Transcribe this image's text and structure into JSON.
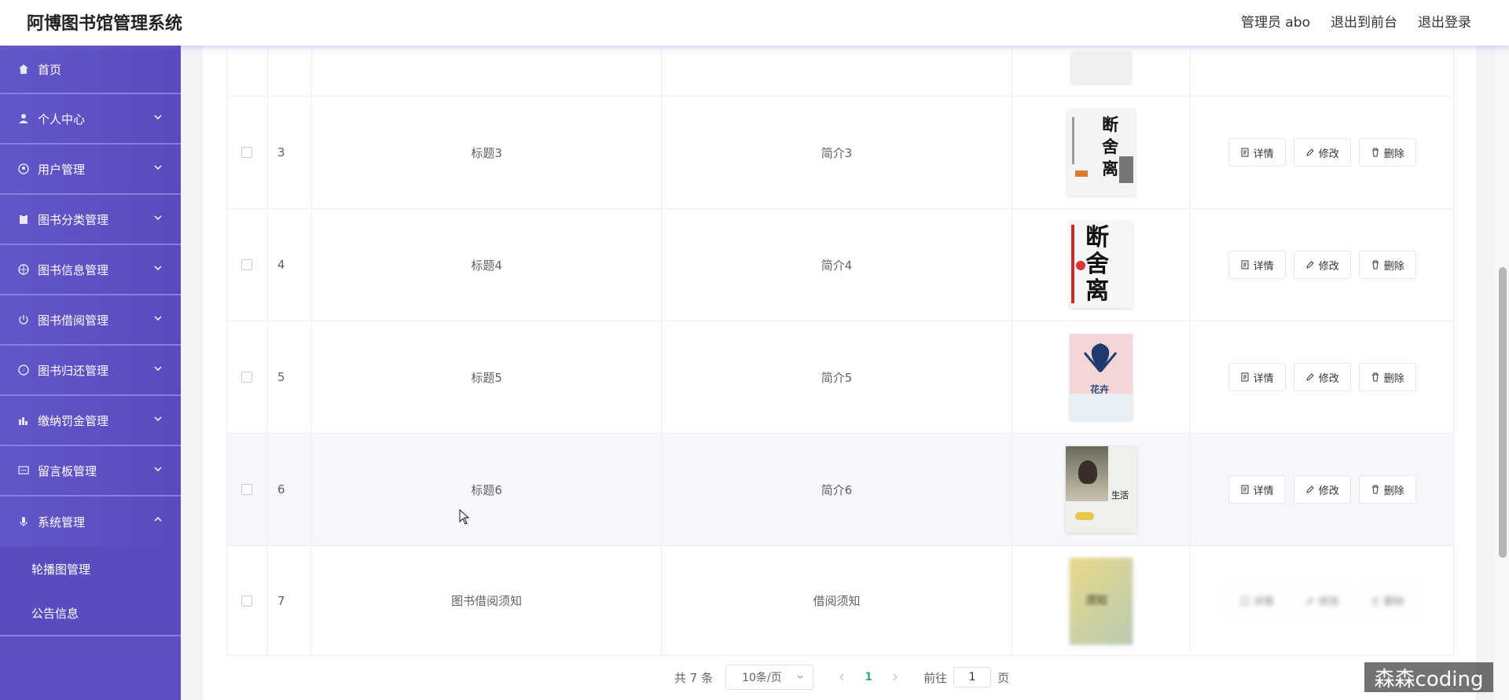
{
  "header": {
    "app_title": "阿博图书馆管理系统",
    "admin_label": "管理员 abo",
    "front_link": "退出到前台",
    "logout_link": "退出登录"
  },
  "sidebar": {
    "items": [
      {
        "label": "首页",
        "icon": "home-icon"
      },
      {
        "label": "个人中心",
        "icon": "user-icon"
      },
      {
        "label": "用户管理",
        "icon": "users-icon"
      },
      {
        "label": "图书分类管理",
        "icon": "clipboard-icon"
      },
      {
        "label": "图书信息管理",
        "icon": "globe-icon"
      },
      {
        "label": "图书借阅管理",
        "icon": "power-icon"
      },
      {
        "label": "图书归还管理",
        "icon": "compass-icon"
      },
      {
        "label": "缴纳罚金管理",
        "icon": "chart-icon"
      },
      {
        "label": "留言板管理",
        "icon": "message-icon"
      },
      {
        "label": "系统管理",
        "icon": "mic-icon"
      }
    ],
    "sub_items": [
      {
        "label": "轮播图管理"
      },
      {
        "label": "公告信息"
      }
    ]
  },
  "table": {
    "rows": [
      {
        "index": "3",
        "title": "标题3",
        "intro": "简介3",
        "cover": "断舍离"
      },
      {
        "index": "4",
        "title": "标题4",
        "intro": "简介4",
        "cover": "断舍离"
      },
      {
        "index": "5",
        "title": "标题5",
        "intro": "简介5",
        "cover": "花卉"
      },
      {
        "index": "6",
        "title": "标题6",
        "intro": "简介6",
        "cover": "生活"
      },
      {
        "index": "7",
        "title": "图书借阅须知",
        "intro": "借阅须知",
        "cover": "须知"
      }
    ],
    "ops": {
      "detail": "详情",
      "edit": "修改",
      "delete": "删除"
    }
  },
  "pagination": {
    "total": "共 7 条",
    "page_size": "10条/页",
    "current_page": "1",
    "goto_label": "前往",
    "goto_value": "1",
    "page_suffix": "页"
  },
  "watermark": "森森coding",
  "colors": {
    "sidebar": "#5c4fc2",
    "accent_page": "#3ba58b"
  }
}
